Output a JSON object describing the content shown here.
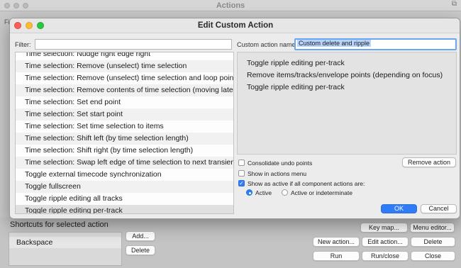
{
  "background": {
    "window_title": "Actions",
    "filter_label_fragment": "Filt",
    "shortcuts_label": "Shortcuts for selected action",
    "shortcut_items": [
      "Backspace"
    ],
    "buttons": {
      "add": "Add...",
      "delete_shortcut": "Delete",
      "key_map": "Key map...",
      "menu_editor": "Menu editor...",
      "new_action": "New action...",
      "edit_action": "Edit action...",
      "delete": "Delete",
      "run": "Run",
      "run_close": "Run/close",
      "close": "Close"
    }
  },
  "dialog": {
    "title": "Edit Custom Action",
    "filter_label": "Filter:",
    "filter_value": "",
    "custom_name_label": "Custom action name:",
    "custom_name_value": "Custom delete and ripple",
    "action_list": [
      "Time selection: Nudge right edge right",
      "Time selection: Remove (unselect) time selection",
      "Time selection: Remove (unselect) time selection and loop points",
      "Time selection: Remove contents of time selection (moving later items)",
      "Time selection: Set end point",
      "Time selection: Set start point",
      "Time selection: Set time selection to items",
      "Time selection: Shift left (by time selection length)",
      "Time selection: Shift right (by time selection length)",
      "Time selection: Swap left edge of time selection to next transient in items",
      "Toggle external timecode synchronization",
      "Toggle fullscreen",
      "Toggle ripple editing all tracks",
      "Toggle ripple editing per-track"
    ],
    "selected_action_index": 13,
    "component_actions": [
      "Toggle ripple editing per-track",
      "Remove items/tracks/envelope points (depending on focus)",
      "Toggle ripple editing per-track"
    ],
    "options": {
      "consolidate_undo": {
        "label": "Consolidate undo points",
        "checked": false
      },
      "show_in_menu": {
        "label": "Show in actions menu",
        "checked": false
      },
      "show_active": {
        "label": "Show as active if all component actions are:",
        "checked": true
      },
      "radio_active": {
        "label": "Active",
        "selected": true
      },
      "radio_active_or_indeterminate": {
        "label": "Active or indeterminate",
        "selected": false
      }
    },
    "buttons": {
      "remove_action": "Remove action",
      "ok": "OK",
      "cancel": "Cancel"
    },
    "accent_color": "#2f7cf6"
  }
}
